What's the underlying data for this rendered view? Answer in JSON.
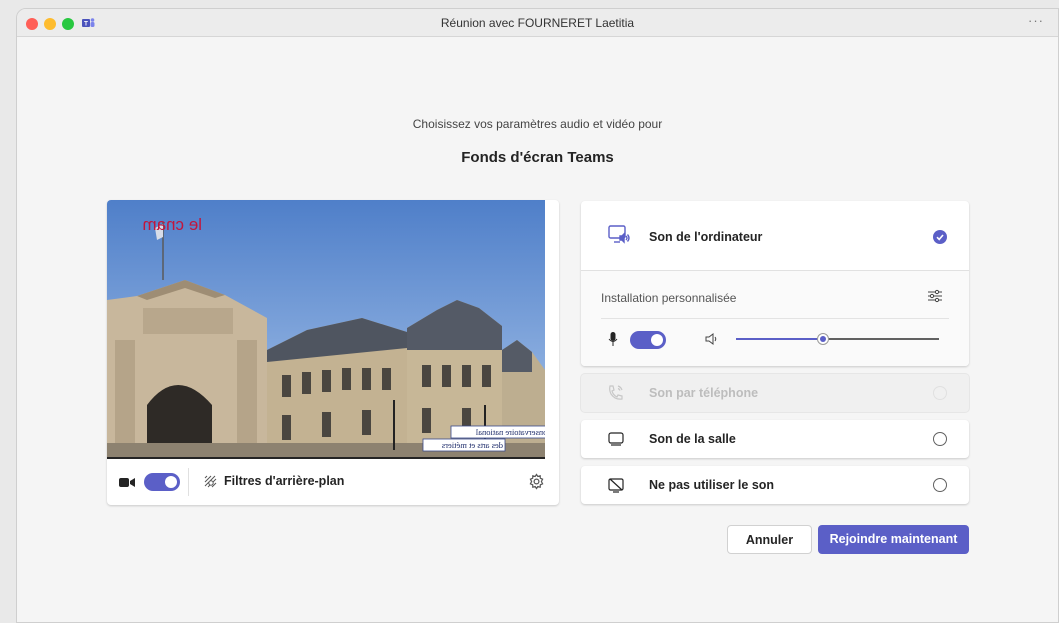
{
  "window": {
    "title": "Réunion avec FOURNERET Laetitia",
    "more_label": "···"
  },
  "prejoin": {
    "subtitle": "Choisissez vos paramètres audio et vidéo pour",
    "meeting_name": "Fonds d'écran Teams"
  },
  "video": {
    "watermark": "le cnam",
    "caption_line1": "Conservatoire national",
    "caption_line2": "des arts et métiers",
    "camera_on": true,
    "filters_label": "Filtres d'arrière-plan"
  },
  "audio": {
    "computer_sound": {
      "label": "Son de l'ordinateur",
      "selected": true
    },
    "custom_setup_label": "Installation personnalisée",
    "mic_on": true,
    "speaker_volume_fraction": 0.43,
    "options": [
      {
        "label": "Son par téléphone",
        "disabled": true,
        "icon": "phone-audio-icon"
      },
      {
        "label": "Son de la salle",
        "disabled": false,
        "icon": "room-audio-icon"
      },
      {
        "label": "Ne pas utiliser le son",
        "disabled": false,
        "icon": "no-audio-icon"
      }
    ]
  },
  "actions": {
    "cancel_label": "Annuler",
    "join_label": "Rejoindre maintenant"
  },
  "colors": {
    "accent": "#5b5fc7"
  }
}
